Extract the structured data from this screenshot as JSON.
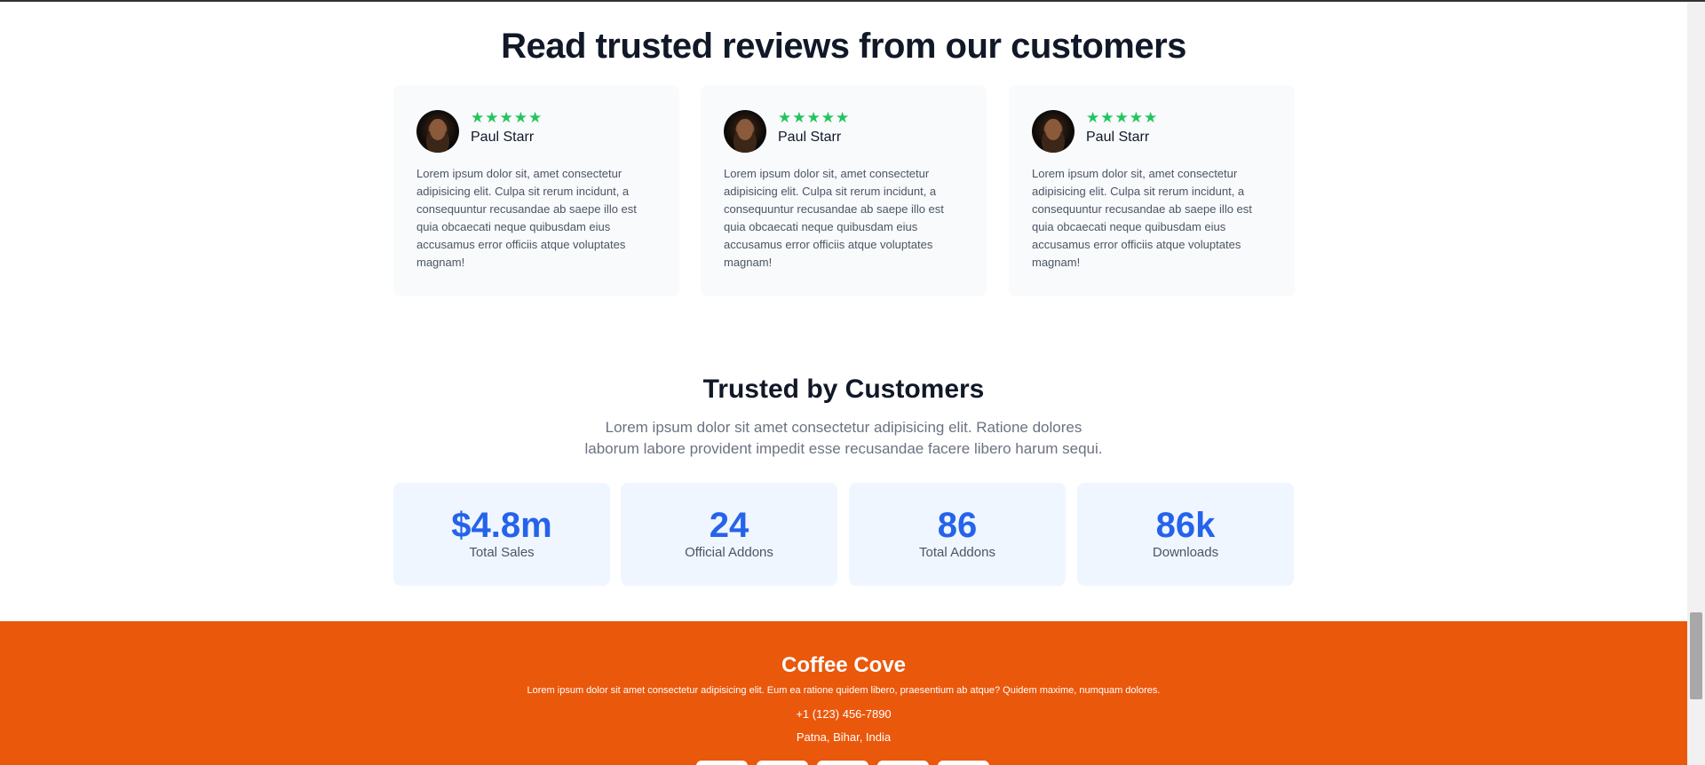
{
  "reviews": {
    "title": "Read trusted reviews from our customers",
    "items": [
      {
        "stars": "★★★★★",
        "name": "Paul Starr",
        "text": "Lorem ipsum dolor sit, amet consectetur adipisicing elit. Culpa sit rerum incidunt, a consequuntur recusandae ab saepe illo est quia obcaecati neque quibusdam eius accusamus error officiis atque voluptates magnam!"
      },
      {
        "stars": "★★★★★",
        "name": "Paul Starr",
        "text": "Lorem ipsum dolor sit, amet consectetur adipisicing elit. Culpa sit rerum incidunt, a consequuntur recusandae ab saepe illo est quia obcaecati neque quibusdam eius accusamus error officiis atque voluptates magnam!"
      },
      {
        "stars": "★★★★★",
        "name": "Paul Starr",
        "text": "Lorem ipsum dolor sit, amet consectetur adipisicing elit. Culpa sit rerum incidunt, a consequuntur recusandae ab saepe illo est quia obcaecati neque quibusdam eius accusamus error officiis atque voluptates magnam!"
      }
    ],
    "rating": 5,
    "star_color": "#22c55e"
  },
  "trusted": {
    "title": "Trusted by Customers",
    "subtitle": "Lorem ipsum dolor sit amet consectetur adipisicing elit. Ratione dolores laborum labore provident impedit esse recusandae facere libero harum sequi.",
    "stats": [
      {
        "value": "$4.8m",
        "label": "Total Sales"
      },
      {
        "value": "24",
        "label": "Official Addons"
      },
      {
        "value": "86",
        "label": "Total Addons"
      },
      {
        "value": "86k",
        "label": "Downloads"
      }
    ],
    "accent_color": "#2563eb"
  },
  "footer": {
    "brand": "Coffee Cove",
    "description": "Lorem ipsum dolor sit amet consectetur adipisicing elit. Eum ea ratione quidem libero, praesentium ab atque? Quidem maxime, numquam dolores.",
    "phone": "+1 (123) 456-7890",
    "location": "Patna, Bihar, India",
    "background_color": "#ea580c"
  }
}
